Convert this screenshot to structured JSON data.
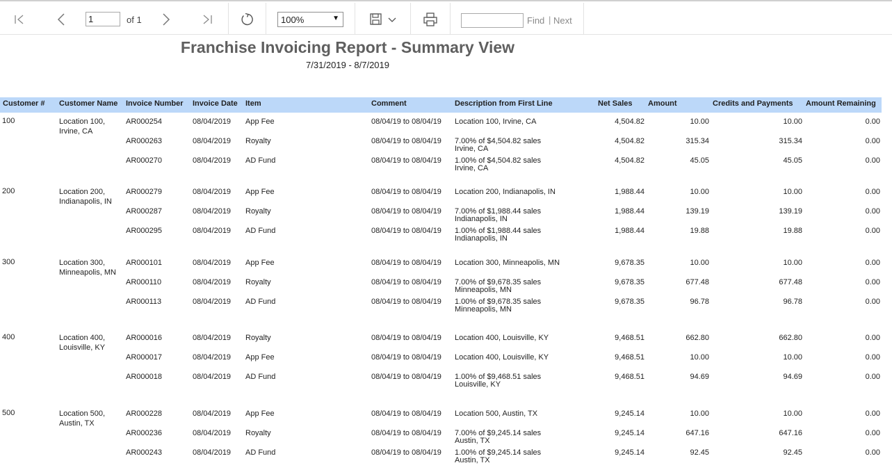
{
  "toolbar": {
    "page_number": "1",
    "page_of": "of 1",
    "zoom": "100%",
    "find_placeholder": "",
    "find_label": "Find",
    "divider": "|",
    "next_label": "Next"
  },
  "report": {
    "title": "Franchise Invoicing Report - Summary View",
    "date_range": "7/31/2019 - 8/7/2019"
  },
  "columns": {
    "customer_num": "Customer #",
    "customer_name": "Customer Name",
    "invoice_number": "Invoice Number",
    "invoice_date": "Invoice Date",
    "item": "Item",
    "comment": "Comment",
    "description": "Description from First Line",
    "net_sales": "Net Sales",
    "amount": "Amount",
    "credits_payments": "Credits and  Payments",
    "amount_remaining": "Amount Remaining"
  },
  "groups": [
    {
      "customer_num": "100",
      "name1": "Location 100,",
      "name2": "Irvine, CA",
      "rows": [
        {
          "invoice": "AR000254",
          "date": "08/04/2019",
          "item": "App Fee",
          "comment": "08/04/19 to 08/04/19",
          "desc1": "Location 100,  Irvine, CA",
          "desc2": "",
          "net_sales": "4,504.82",
          "amount": "10.00",
          "credits": "10.00",
          "remaining": "0.00"
        },
        {
          "invoice": "AR000263",
          "date": "08/04/2019",
          "item": "Royalty",
          "comment": "08/04/19 to 08/04/19",
          "desc1": "7.00% of $4,504.82 sales",
          "desc2": "Irvine, CA",
          "net_sales": "4,504.82",
          "amount": "315.34",
          "credits": "315.34",
          "remaining": "0.00"
        },
        {
          "invoice": "AR000270",
          "date": "08/04/2019",
          "item": "AD Fund",
          "comment": "08/04/19 to 08/04/19",
          "desc1": "1.00% of $4,504.82 sales",
          "desc2": "Irvine, CA",
          "net_sales": "4,504.82",
          "amount": "45.05",
          "credits": "45.05",
          "remaining": "0.00"
        }
      ]
    },
    {
      "customer_num": "200",
      "name1": "Location 200,",
      "name2": "Indianapolis, IN",
      "rows": [
        {
          "invoice": "AR000279",
          "date": "08/04/2019",
          "item": "App Fee",
          "comment": "08/04/19 to 08/04/19",
          "desc1": "Location 200,  Indianapolis, IN",
          "desc2": "",
          "net_sales": "1,988.44",
          "amount": "10.00",
          "credits": "10.00",
          "remaining": "0.00"
        },
        {
          "invoice": "AR000287",
          "date": "08/04/2019",
          "item": "Royalty",
          "comment": "08/04/19 to 08/04/19",
          "desc1": "7.00% of $1,988.44 sales",
          "desc2": "Indianapolis, IN",
          "net_sales": "1,988.44",
          "amount": "139.19",
          "credits": "139.19",
          "remaining": "0.00"
        },
        {
          "invoice": "AR000295",
          "date": "08/04/2019",
          "item": "AD Fund",
          "comment": "08/04/19 to 08/04/19",
          "desc1": "1.00% of $1,988.44 sales",
          "desc2": "Indianapolis, IN",
          "net_sales": "1,988.44",
          "amount": "19.88",
          "credits": "19.88",
          "remaining": "0.00"
        }
      ]
    },
    {
      "customer_num": "300",
      "name1": "Location 300,",
      "name2": "Minneapolis, MN",
      "rows": [
        {
          "invoice": "AR000101",
          "date": "08/04/2019",
          "item": "App Fee",
          "comment": "08/04/19 to 08/04/19",
          "desc1": "Location 300,  Minneapolis, MN",
          "desc2": "",
          "net_sales": "9,678.35",
          "amount": "10.00",
          "credits": "10.00",
          "remaining": "0.00"
        },
        {
          "invoice": "AR000110",
          "date": "08/04/2019",
          "item": "Royalty",
          "comment": "08/04/19 to 08/04/19",
          "desc1": "7.00% of $9,678.35 sales",
          "desc2": "Minneapolis, MN",
          "net_sales": "9,678.35",
          "amount": "677.48",
          "credits": "677.48",
          "remaining": "0.00"
        },
        {
          "invoice": "AR000113",
          "date": "08/04/2019",
          "item": "AD Fund",
          "comment": "08/04/19 to 08/04/19",
          "desc1": "1.00% of $9,678.35 sales",
          "desc2": "Minneapolis, MN",
          "net_sales": "9,678.35",
          "amount": "96.78",
          "credits": "96.78",
          "remaining": "0.00"
        }
      ]
    },
    {
      "customer_num": "400",
      "name1": "Location 400,",
      "name2": "Louisville, KY",
      "rows": [
        {
          "invoice": "AR000016",
          "date": "08/04/2019",
          "item": "Royalty",
          "comment": "08/04/19 to 08/04/19",
          "desc1": "Location 400,  Louisville, KY",
          "desc2": "",
          "net_sales": "9,468.51",
          "amount": "662.80",
          "credits": "662.80",
          "remaining": "0.00"
        },
        {
          "invoice": "AR000017",
          "date": "08/04/2019",
          "item": "App Fee",
          "comment": "08/04/19 to 08/04/19",
          "desc1": "Location 400,  Louisville, KY",
          "desc2": "",
          "net_sales": "9,468.51",
          "amount": "10.00",
          "credits": "10.00",
          "remaining": "0.00"
        },
        {
          "invoice": "AR000018",
          "date": "08/04/2019",
          "item": "AD Fund",
          "comment": "08/04/19 to 08/04/19",
          "desc1": "1.00% of $9,468.51 sales",
          "desc2": "Louisville, KY",
          "net_sales": "9,468.51",
          "amount": "94.69",
          "credits": "94.69",
          "remaining": "0.00"
        }
      ]
    },
    {
      "customer_num": "500",
      "name1": "Location 500,",
      "name2": "Austin, TX",
      "rows": [
        {
          "invoice": "AR000228",
          "date": "08/04/2019",
          "item": "App Fee",
          "comment": "08/04/19 to 08/04/19",
          "desc1": "Location 500,  Austin, TX",
          "desc2": "",
          "net_sales": "9,245.14",
          "amount": "10.00",
          "credits": "10.00",
          "remaining": "0.00"
        },
        {
          "invoice": "AR000236",
          "date": "08/04/2019",
          "item": "Royalty",
          "comment": "08/04/19 to 08/04/19",
          "desc1": "7.00% of $9,245.14 sales",
          "desc2": "Austin, TX",
          "net_sales": "9,245.14",
          "amount": "647.16",
          "credits": "647.16",
          "remaining": "0.00"
        },
        {
          "invoice": "AR000243",
          "date": "08/04/2019",
          "item": "AD Fund",
          "comment": "08/04/19 to 08/04/19",
          "desc1": "1.00% of $9,245.14 sales",
          "desc2": "Austin, TX",
          "net_sales": "9,245.14",
          "amount": "92.45",
          "credits": "92.45",
          "remaining": "0.00"
        }
      ]
    }
  ]
}
